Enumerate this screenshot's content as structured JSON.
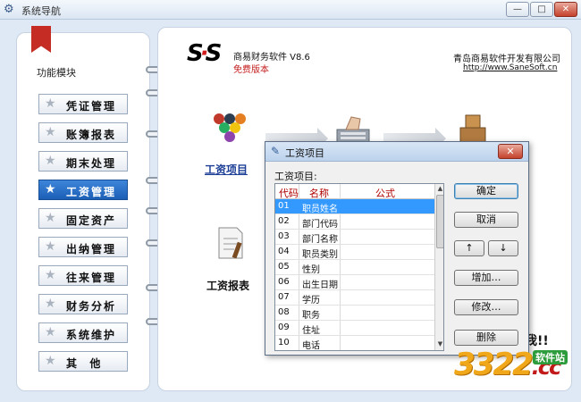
{
  "window": {
    "title": "系统导航",
    "minimize": "—",
    "maximize": "□",
    "close": "✕"
  },
  "sidebar": {
    "module_label": "功能模块",
    "items": [
      {
        "label": "凭证管理"
      },
      {
        "label": "账簿报表"
      },
      {
        "label": "期末处理"
      },
      {
        "label": "工资管理",
        "active": true
      },
      {
        "label": "固定资产"
      },
      {
        "label": "出纳管理"
      },
      {
        "label": "往来管理"
      },
      {
        "label": "财务分析"
      },
      {
        "label": "系统维护"
      },
      {
        "label": "其  他"
      }
    ]
  },
  "header": {
    "logo_text": "SS",
    "product": "商易财务软件 V8.6",
    "edition": "免费版本",
    "company": "青岛商易软件开发有限公司",
    "url": "http://www.SaneSoft.cn"
  },
  "main": {
    "features": [
      {
        "label": "工资项目",
        "icon": "billiards-icon"
      },
      {
        "label": "工资报表",
        "icon": "report-icon"
      }
    ],
    "bubble_text": "我!!"
  },
  "dialog": {
    "title": "工资项目",
    "close": "✕",
    "subtitle": "工资项目:",
    "columns": [
      "代码",
      "名称",
      "公式"
    ],
    "rows": [
      {
        "code": "01",
        "name": "职员姓名",
        "formula": "",
        "selected": true
      },
      {
        "code": "02",
        "name": "部门代码",
        "formula": ""
      },
      {
        "code": "03",
        "name": "部门名称",
        "formula": ""
      },
      {
        "code": "04",
        "name": "职员类别",
        "formula": ""
      },
      {
        "code": "05",
        "name": "性别",
        "formula": ""
      },
      {
        "code": "06",
        "name": "出生日期",
        "formula": ""
      },
      {
        "code": "07",
        "name": "学历",
        "formula": ""
      },
      {
        "code": "08",
        "name": "职务",
        "formula": ""
      },
      {
        "code": "09",
        "name": "住址",
        "formula": ""
      },
      {
        "code": "10",
        "name": "电话",
        "formula": ""
      }
    ],
    "buttons": {
      "ok": "确定",
      "cancel": "取消",
      "up": "↑",
      "down": "↓",
      "add": "增加…",
      "edit": "修改…",
      "delete": "删除"
    }
  },
  "watermark": {
    "digits": "3322",
    "suffix": ".cc",
    "site": "软件站"
  }
}
